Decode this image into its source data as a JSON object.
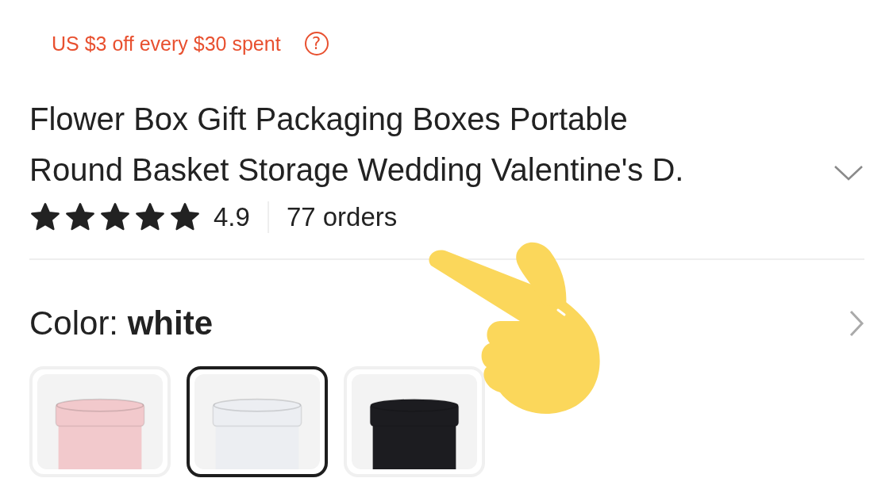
{
  "promo": {
    "text": "US $3 off every $30 spent",
    "help": "?"
  },
  "title": {
    "lines": [
      "Flower Box Gift Packaging Boxes Portable",
      "Round Basket Storage Wedding Valentine's D."
    ],
    "expanded": false
  },
  "rating": {
    "stars": 5,
    "score": "4.9",
    "orders": "77 orders"
  },
  "color": {
    "label": "Color: **white**"
  },
  "options": [
    {
      "kind": "picture",
      "selected": false,
      "color": "#f2c9cc"
    },
    {
      "kind": "picture",
      "selected": true,
      "color": "#eceef2"
    },
    {
      "kind": "picture",
      "selected": false,
      "color": "#1c1c20"
    }
  ]
}
